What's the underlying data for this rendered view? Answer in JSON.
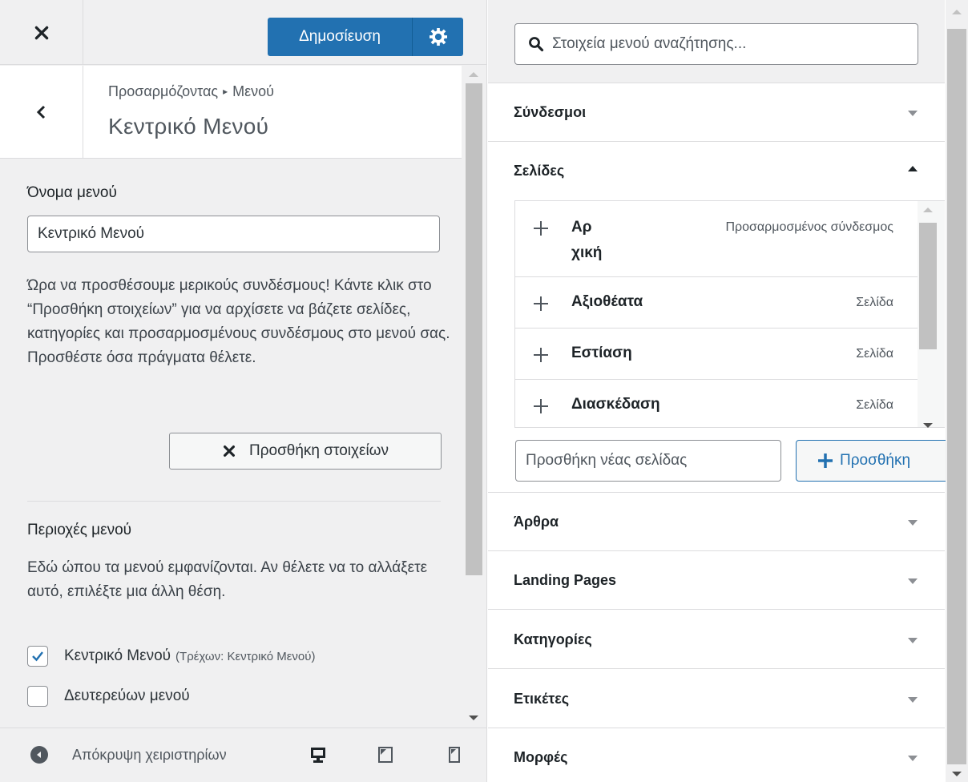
{
  "colors": {
    "accent": "#2271b1",
    "panel_bg": "#f0f0f1",
    "border": "#dcdcde"
  },
  "topbar": {
    "publish_label": "Δημοσίευση",
    "close_icon": "close-icon",
    "gear_icon": "gear-icon"
  },
  "header": {
    "breadcrumb_parent": "Προσαρμόζοντας",
    "breadcrumb_child": "Μενού",
    "title": "Κεντρικό Μενού"
  },
  "menu_name": {
    "label": "Όνομα μενού",
    "value": "Κεντρικό Μενού"
  },
  "help_text": "Ώρα να προσθέσουμε μερικούς συνδέσμους! Κάντε κλικ στο “Προσθήκη στοιχείων” για να αρχίσετε να βάζετε σελίδες, κατηγορίες και προσαρμοσμένους συνδέσμους στο μενού σας. Προσθέστε όσα πράγματα θέλετε.",
  "add_items_label": "Προσθήκη στοιχείων",
  "menu_locations": {
    "label": "Περιοχές μενού",
    "description": "Εδώ ώπου τα μενού εμφανίζονται. Αν θέλετε να το αλλάξετε αυτό, επιλέξτε μια άλλη θέση.",
    "items": [
      {
        "label": "Κεντρικό Μενού",
        "note": "(Τρέχων: Κεντρικό Μενού)",
        "checked": true
      },
      {
        "label": "Δευτερεύων μενού",
        "note": "",
        "checked": false
      }
    ]
  },
  "footer": {
    "collapse_label": "Απόκρυψη χειριστηρίων"
  },
  "search": {
    "placeholder": "Στοιχεία μενού αναζήτησης..."
  },
  "sections": {
    "links": "Σύνδεσμοι",
    "pages": "Σελίδες",
    "posts": "Άρθρα",
    "landing": "Landing Pages",
    "categories": "Κατηγορίες",
    "tags": "Ετικέτες",
    "formats": "Μορφές"
  },
  "pages": {
    "items": [
      {
        "name_line1": "Αρ",
        "name_line2": "χική",
        "type": "Προσαρμοσμένος σύνδεσμος"
      },
      {
        "name": "Αξιοθέατα",
        "type": "Σελίδα"
      },
      {
        "name": "Εστίαση",
        "type": "Σελίδα"
      },
      {
        "name": "Διασκέδαση",
        "type": "Σελίδα"
      }
    ],
    "new_page_placeholder": "Προσθήκη νέας σελίδας",
    "add_button": "Προσθήκη"
  }
}
